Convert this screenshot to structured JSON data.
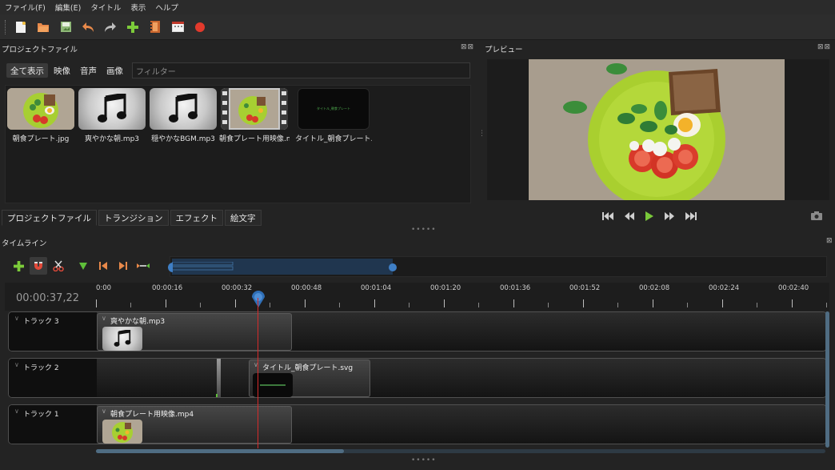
{
  "menu": [
    "ファイル(F)",
    "編集(E)",
    "タイトル",
    "表示",
    "ヘルプ"
  ],
  "toolbar": {
    "buttons": [
      "new-project-icon",
      "open-project-icon",
      "save-project-icon",
      "undo-icon",
      "redo-icon",
      "import-files-icon",
      "choose-profile-icon",
      "fullscreen-icon",
      "export-video-icon"
    ]
  },
  "project_files": {
    "title": "プロジェクトファイル",
    "filter_tabs": [
      "全て表示",
      "映像",
      "音声",
      "画像"
    ],
    "filter_placeholder": "フィルター",
    "files": [
      {
        "name": "朝食プレート.jpg",
        "kind": "photo"
      },
      {
        "name": "爽やかな朝.mp3",
        "kind": "music"
      },
      {
        "name": "穏やかなBGM.mp3",
        "kind": "music"
      },
      {
        "name": "朝食プレート用映像.mp",
        "kind": "video"
      },
      {
        "name": "タイトル_朝食プレート.svg",
        "kind": "title",
        "thumb_text": "タイトル_朝食プレート"
      }
    ]
  },
  "bottom_tabs": [
    "プロジェクトファイル",
    "トランジション",
    "エフェクト",
    "絵文字"
  ],
  "preview": {
    "title": "プレビュー"
  },
  "timeline": {
    "title": "タイムライン",
    "timecode": "00:00:37,22",
    "ticks": [
      "0:00",
      "00:00:16",
      "00:00:32",
      "00:00:48",
      "00:01:04",
      "00:01:20",
      "00:01:36",
      "00:01:52",
      "00:02:08",
      "00:02:24",
      "00:02:40"
    ],
    "tracks": [
      {
        "name": "トラック 3",
        "clips": [
          {
            "name": "爽やかな朝.mp3",
            "kind": "music"
          }
        ]
      },
      {
        "name": "トラック 2",
        "clips": [
          {
            "name": "タイトル_朝食プレート.svg",
            "kind": "title"
          }
        ]
      },
      {
        "name": "トラック 1",
        "clips": [
          {
            "name": "朝食プレート用映像.mp4",
            "kind": "photo"
          }
        ]
      }
    ]
  },
  "colors": {
    "accent": "#4f6c82",
    "playhead": "#d62b2b",
    "background": "#232323"
  }
}
